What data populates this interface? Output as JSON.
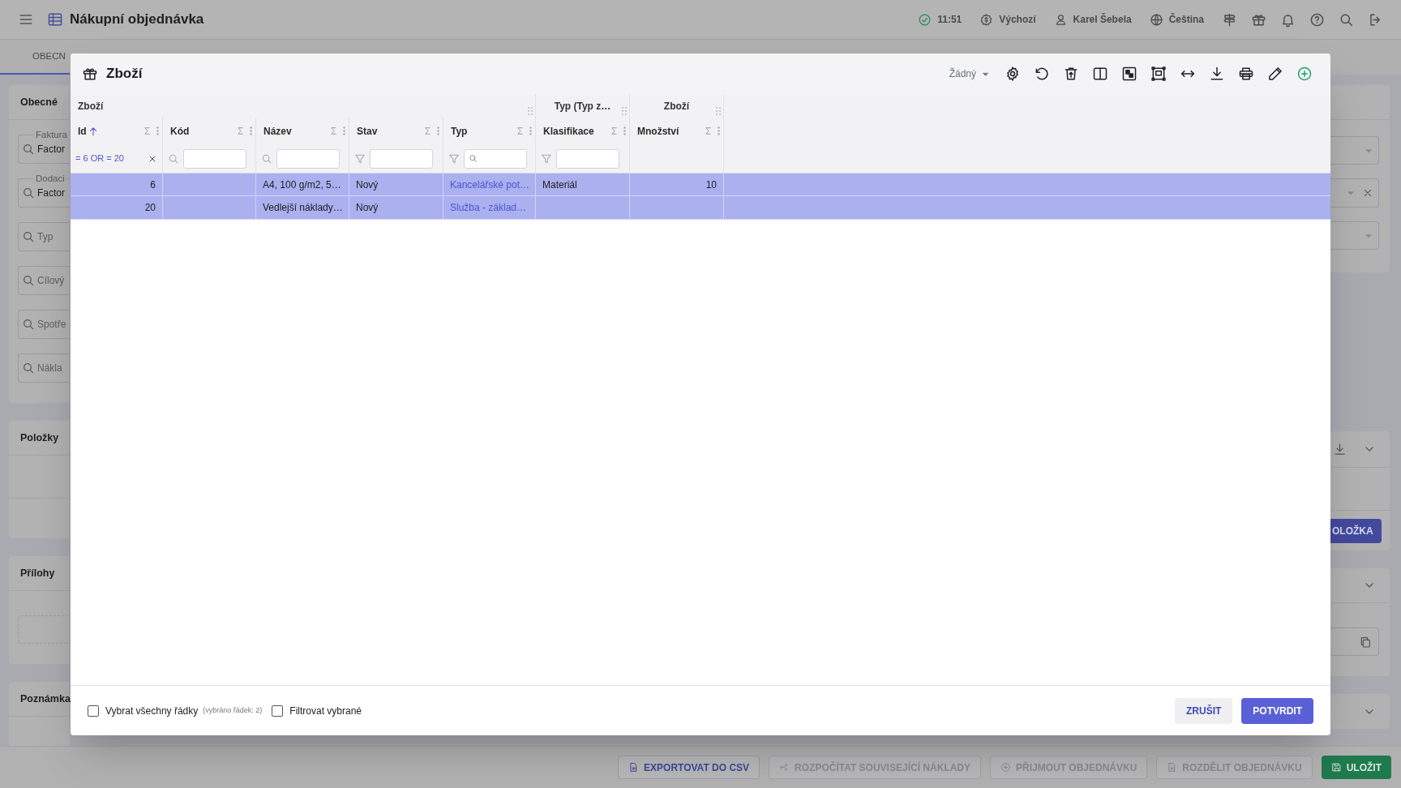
{
  "app_bar": {
    "title": "Nákupní objednávka",
    "status": [
      {
        "kind": "sync",
        "text": "11:51"
      },
      {
        "kind": "currency",
        "text": "Výchozí"
      },
      {
        "kind": "user",
        "text": "Karel Šebela"
      },
      {
        "kind": "language",
        "text": "Čeština"
      }
    ]
  },
  "tabs": [
    {
      "label": "OBECN",
      "selected": true
    }
  ],
  "form_cards": [
    {
      "title": "Obecné",
      "fields": [
        {
          "kind": "value",
          "label": "Faktura",
          "value": "Factor"
        },
        {
          "kind": "value",
          "label": "Dodaci",
          "value": "Factor"
        },
        {
          "kind": "search",
          "placeholder": "Typ"
        },
        {
          "kind": "search",
          "placeholder": "Cílový"
        },
        {
          "kind": "search",
          "placeholder": "Spotře"
        },
        {
          "kind": "search",
          "placeholder": "Nákla"
        }
      ]
    },
    {
      "title": "Položky"
    },
    {
      "title": "Přílohy"
    },
    {
      "title": "Poznámka"
    }
  ],
  "items_add_button": "OLOŽKA",
  "dialog": {
    "title": "Zboží",
    "preset": "Žádný",
    "column_groups": [
      {
        "label": "Zboží",
        "columns": [
          {
            "label": "Id",
            "kind": "number",
            "sorted": true,
            "filter": {
              "kind": "expression",
              "text": "= 6 OR = 20"
            }
          },
          {
            "label": "Kód",
            "kind": "text",
            "sorted": false,
            "filter": {
              "kind": "search"
            }
          },
          {
            "label": "Název",
            "kind": "text",
            "sorted": false,
            "filter": {
              "kind": "search"
            }
          },
          {
            "label": "Stav",
            "kind": "text",
            "sorted": false,
            "filter": {
              "kind": "filter"
            }
          },
          {
            "label": "Typ",
            "kind": "link",
            "sorted": false,
            "filter": {
              "kind": "filter_search"
            }
          }
        ]
      },
      {
        "label": "Typ (Typ z…",
        "columns": [
          {
            "label": "Klasifikace",
            "kind": "text",
            "sorted": false,
            "filter": {
              "kind": "filter"
            }
          }
        ]
      },
      {
        "label": "Zboží",
        "columns": [
          {
            "label": "Množství",
            "kind": "number",
            "sorted": false
          }
        ]
      }
    ],
    "rows": [
      {
        "selected": true,
        "cells": [
          "6",
          null,
          "A4, 100 g/m2, 5…",
          "Nový",
          "Kancelářské pot…",
          "Materiál",
          "10"
        ]
      },
      {
        "selected": true,
        "cells": [
          "20",
          null,
          "Vedlejší náklady…",
          "Nový",
          "Služba - základ…",
          null,
          null
        ]
      }
    ],
    "select_all": {
      "label": "Vybrat všechny řádky",
      "note": "(vybráno řádek: 2)",
      "checked": false
    },
    "filter_selected": {
      "label": "Filtrovat vybrané",
      "checked": false
    },
    "buttons": [
      {
        "label": "ZRUŠIT",
        "kind": "secondary"
      },
      {
        "label": "POTVRDIT",
        "kind": "primary"
      }
    ]
  },
  "bottom_bar": {
    "buttons": [
      {
        "label": "EXPORTOVAT DO CSV",
        "kind": "outline"
      },
      {
        "label": "ROZPOČÍTAT SOUVISEJÍCÍ NÁKLADY",
        "kind": "disabled"
      },
      {
        "label": "PŘIJMOUT OBJEDNÁVKU",
        "kind": "disabled"
      },
      {
        "label": "ROZDĚLIT OBJEDNÁVKU",
        "kind": "disabled"
      },
      {
        "label": "ULOŽIT",
        "kind": "success"
      }
    ]
  }
}
